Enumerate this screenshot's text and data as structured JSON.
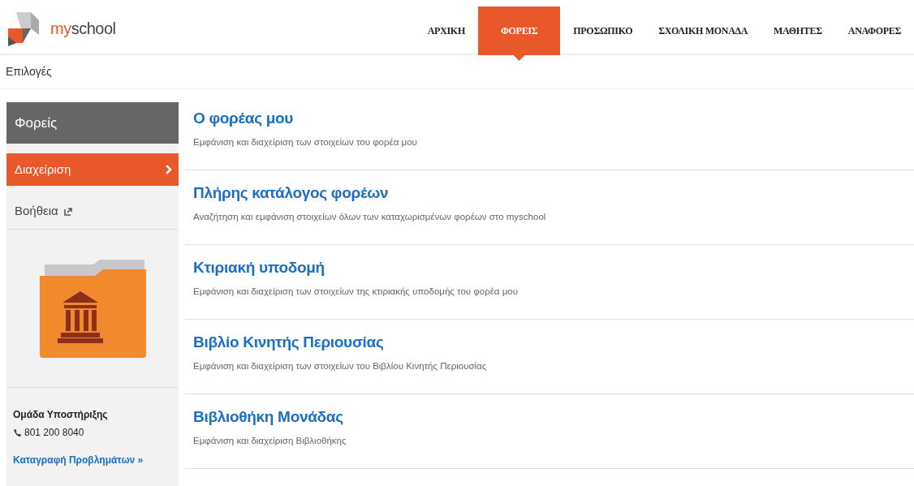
{
  "logo": {
    "prefix": "my",
    "suffix": "school"
  },
  "nav": [
    {
      "label": "ΑΡΧΙΚΗ",
      "selected": false
    },
    {
      "label": "ΦΟΡΕΙΣ",
      "selected": true
    },
    {
      "label": "ΠΡΟΣΩΠΙΚΟ",
      "selected": false
    },
    {
      "label": "ΣΧΟΛΙΚΗ ΜΟΝΑΔΑ",
      "selected": false
    },
    {
      "label": "ΜΑΘΗΤΕΣ",
      "selected": false
    },
    {
      "label": "ΑΝΑΦΟΡΕΣ",
      "selected": false
    }
  ],
  "breadcrumb": "Επιλογές",
  "sidebar": {
    "title": "Φορείς",
    "items": [
      {
        "label": "Διαχείριση",
        "selected": true,
        "kind": "page"
      },
      {
        "label": "Βοήθεια",
        "selected": false,
        "kind": "external"
      }
    ],
    "support": {
      "title": "Ομάδα Υποστήριξης",
      "phone": "801 200 8040",
      "link": "Καταγραφή Προβλημάτων »"
    }
  },
  "options": [
    {
      "title": "Ο φορέας μου",
      "description": "Εμφάνιση και διαχείριση των στοιχείων του φορέα μου"
    },
    {
      "title": "Πλήρης κατάλογος φορέων",
      "description": "Αναζήτηση και εμφάνιση στοιχείων όλων των καταχωρισμένων φορέων στο myschool"
    },
    {
      "title": "Κτιριακή υποδομή",
      "description": "Εμφάνιση και διαχείριση των στοιχείων της κτιριακής υποδομής του φορέα μου"
    },
    {
      "title": "Βιβλίο Κινητής Περιουσίας",
      "description": "Εμφάνιση και διαχείριση των στοιχείων του Βιβλίου Κινητής Περιουσίας"
    },
    {
      "title": "Βιβλιοθήκη Μονάδας",
      "description": "Εμφάνιση και διαχείριση Βιβλιοθήκης"
    }
  ]
}
